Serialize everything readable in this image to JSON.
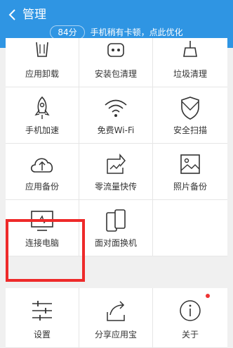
{
  "header": {
    "title": "管理",
    "score": "84分",
    "hint": "手机稍有卡顿，点此优化"
  },
  "tools": [
    {
      "label": "应用卸载",
      "icon": "trash-icon"
    },
    {
      "label": "安装包清理",
      "icon": "robot-icon"
    },
    {
      "label": "垃圾清理",
      "icon": "broom-icon"
    },
    {
      "label": "手机加速",
      "icon": "rocket-icon"
    },
    {
      "label": "免费Wi-Fi",
      "icon": "wifi-icon"
    },
    {
      "label": "安全扫描",
      "icon": "shield-icon"
    },
    {
      "label": "应用备份",
      "icon": "cloud-upload-icon"
    },
    {
      "label": "零流量快传",
      "icon": "transfer-icon"
    },
    {
      "label": "照片备份",
      "icon": "photo-icon"
    },
    {
      "label": "连接电脑",
      "icon": "monitor-icon"
    },
    {
      "label": "面对面换机",
      "icon": "phones-icon"
    }
  ],
  "bottom": [
    {
      "label": "设置",
      "icon": "settings-sliders-icon"
    },
    {
      "label": "分享应用宝",
      "icon": "share-icon"
    },
    {
      "label": "关于",
      "icon": "info-icon"
    }
  ],
  "colors": {
    "header": "#2f95e3",
    "highlight": "#ee2a2a",
    "notification_dot": "#ee3333"
  }
}
